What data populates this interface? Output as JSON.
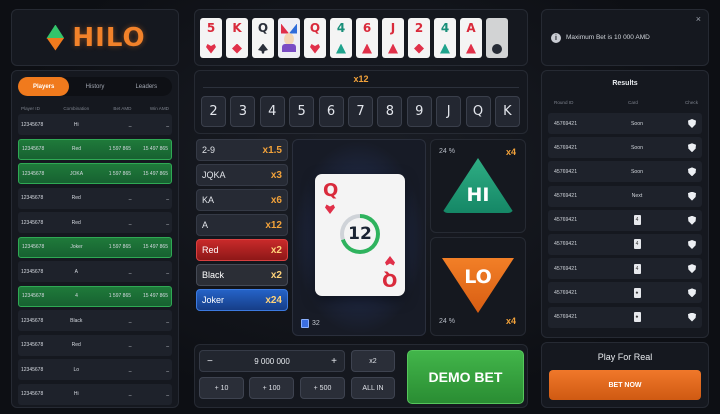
{
  "logo": {
    "text": "HILO"
  },
  "players": {
    "tabs": [
      "Players",
      "History",
      "Leaders"
    ],
    "active_tab": "Players",
    "columns": [
      "Player ID",
      "Combination",
      "Bet AMD",
      "Win AMD"
    ],
    "rows": [
      {
        "id": "12345678",
        "combo": "Hi",
        "bet": "_",
        "win": "_",
        "won": false
      },
      {
        "id": "12345678",
        "combo": "Red",
        "bet": "1 597 865",
        "win": "15 497 865",
        "won": true
      },
      {
        "id": "12345678",
        "combo": "JOKA",
        "bet": "1 597 865",
        "win": "15 497 865",
        "won": true
      },
      {
        "id": "12345678",
        "combo": "Red",
        "bet": "_",
        "win": "_",
        "won": false
      },
      {
        "id": "12345678",
        "combo": "Red",
        "bet": "_",
        "win": "_",
        "won": false
      },
      {
        "id": "12345678",
        "combo": "Joker",
        "bet": "1 597 865",
        "win": "15 497 865",
        "won": true
      },
      {
        "id": "12345678",
        "combo": "A",
        "bet": "_",
        "win": "_",
        "won": false
      },
      {
        "id": "12345678",
        "combo": "4",
        "bet": "1 597 865",
        "win": "15 497 865",
        "won": true
      },
      {
        "id": "12345678",
        "combo": "Black",
        "bet": "_",
        "win": "_",
        "won": false
      },
      {
        "id": "12345678",
        "combo": "Red",
        "bet": "_",
        "win": "_",
        "won": false
      },
      {
        "id": "12345678",
        "combo": "Lo",
        "bet": "_",
        "win": "_",
        "won": false
      },
      {
        "id": "12345678",
        "combo": "Hi",
        "bet": "_",
        "win": "_",
        "won": false
      }
    ]
  },
  "history_cards": [
    {
      "rank": "5",
      "suit": "heart",
      "color": "#d92a3b"
    },
    {
      "rank": "K",
      "suit": "diamond",
      "color": "#d92a3b"
    },
    {
      "rank": "Q",
      "suit": "spade",
      "color": "#2a2f3a"
    },
    {
      "rank": "",
      "suit": "joker",
      "color": "#2a2f3a"
    },
    {
      "rank": "Q",
      "suit": "heart",
      "color": "#d92a3b"
    },
    {
      "rank": "4",
      "suit": "tri-green",
      "color": "#1a8f7a"
    },
    {
      "rank": "6",
      "suit": "tri-red",
      "color": "#d92a3b"
    },
    {
      "rank": "J",
      "suit": "tri-red",
      "color": "#d92a3b"
    },
    {
      "rank": "2",
      "suit": "diamond",
      "color": "#d92a3b"
    },
    {
      "rank": "4",
      "suit": "tri-green",
      "color": "#1a8f7a"
    },
    {
      "rank": "A",
      "suit": "tri-red",
      "color": "#d92a3b"
    },
    {
      "rank": "",
      "suit": "club",
      "color": "#2a2f3a"
    }
  ],
  "rank_bet": {
    "multiplier": "x12",
    "ranks": [
      "2",
      "3",
      "4",
      "5",
      "6",
      "7",
      "8",
      "9",
      "J",
      "Q",
      "K"
    ]
  },
  "side_bets": [
    {
      "label": "2-9",
      "mult": "x1.5",
      "style": "plain"
    },
    {
      "label": "JQKA",
      "mult": "x3",
      "style": "plain"
    },
    {
      "label": "KA",
      "mult": "x6",
      "style": "plain"
    },
    {
      "label": "A",
      "mult": "x12",
      "style": "plain"
    },
    {
      "label": "Red",
      "mult": "x2",
      "style": "red"
    },
    {
      "label": "Black",
      "mult": "x2",
      "style": "black"
    },
    {
      "label": "Joker",
      "mult": "x24",
      "style": "joker"
    }
  ],
  "current_card": {
    "rank": "Q",
    "timer": "12",
    "timer_progress": 0.7,
    "deck_count": "32"
  },
  "hi": {
    "label": "HI",
    "percent": "24 %",
    "mult": "x4"
  },
  "lo": {
    "label": "LO",
    "percent": "24 %",
    "mult": "x4"
  },
  "bet": {
    "minus": "−",
    "plus": "+",
    "amount": "9 000 000",
    "x2": "x2",
    "quick": [
      "+ 10",
      "+ 100",
      "+ 500"
    ],
    "all_in": "ALL IN",
    "demo_bet": "DEMO BET"
  },
  "notice": {
    "icon": "info-icon",
    "text": "Maximum Bet is 10 000 AMD",
    "close": "×"
  },
  "results": {
    "title": "Results",
    "columns": [
      "Round ID",
      "Card",
      "Check"
    ],
    "rows": [
      {
        "id": "45769421",
        "card": "Soon",
        "type": "text"
      },
      {
        "id": "45769421",
        "card": "Soon",
        "type": "text"
      },
      {
        "id": "45769421",
        "card": "Soon",
        "type": "text"
      },
      {
        "id": "45769421",
        "card": "Next",
        "type": "text"
      },
      {
        "id": "45769421",
        "card": "4",
        "type": "card"
      },
      {
        "id": "45769421",
        "card": "4",
        "type": "card"
      },
      {
        "id": "45769421",
        "card": "4",
        "type": "card"
      },
      {
        "id": "45769421",
        "card": "♠",
        "type": "card"
      },
      {
        "id": "45769421",
        "card": "♠",
        "type": "card"
      }
    ]
  },
  "play_real": {
    "title": "Play For Real",
    "button": "BET NOW"
  },
  "colors": {
    "accent": "#f07a1d",
    "win_green": "#1f7a3a",
    "hi_green": "#1fa38d",
    "demo_green": "#42b54a"
  }
}
